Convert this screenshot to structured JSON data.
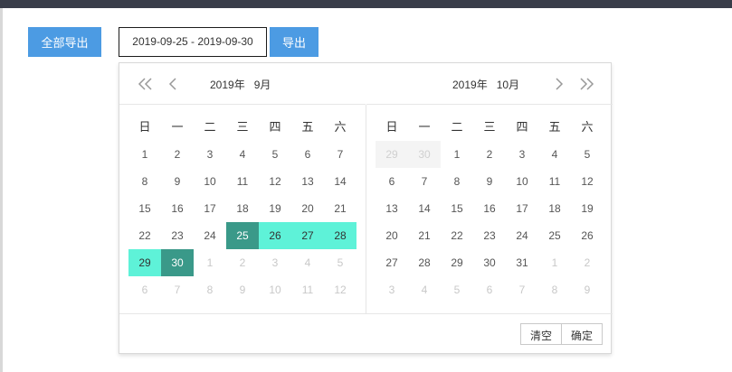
{
  "toolbar": {
    "export_all_label": "全部导出",
    "date_range_value": "2019-09-25 - 2019-09-30",
    "export_label": "导出"
  },
  "picker": {
    "left": {
      "year_label": "2019年",
      "month_label": "9月",
      "weekdays": [
        "日",
        "一",
        "二",
        "三",
        "四",
        "五",
        "六"
      ],
      "days": [
        {
          "label": "1",
          "state": "current"
        },
        {
          "label": "2",
          "state": "current"
        },
        {
          "label": "3",
          "state": "current"
        },
        {
          "label": "4",
          "state": "current"
        },
        {
          "label": "5",
          "state": "current"
        },
        {
          "label": "6",
          "state": "current"
        },
        {
          "label": "7",
          "state": "current"
        },
        {
          "label": "8",
          "state": "current"
        },
        {
          "label": "9",
          "state": "current"
        },
        {
          "label": "10",
          "state": "current"
        },
        {
          "label": "11",
          "state": "current"
        },
        {
          "label": "12",
          "state": "current"
        },
        {
          "label": "13",
          "state": "current"
        },
        {
          "label": "14",
          "state": "current"
        },
        {
          "label": "15",
          "state": "current"
        },
        {
          "label": "16",
          "state": "current"
        },
        {
          "label": "17",
          "state": "current"
        },
        {
          "label": "18",
          "state": "current"
        },
        {
          "label": "19",
          "state": "current"
        },
        {
          "label": "20",
          "state": "current"
        },
        {
          "label": "21",
          "state": "current"
        },
        {
          "label": "22",
          "state": "current"
        },
        {
          "label": "23",
          "state": "current"
        },
        {
          "label": "24",
          "state": "current"
        },
        {
          "label": "25",
          "state": "selected"
        },
        {
          "label": "26",
          "state": "inrange"
        },
        {
          "label": "27",
          "state": "inrange"
        },
        {
          "label": "28",
          "state": "inrange"
        },
        {
          "label": "29",
          "state": "inrange"
        },
        {
          "label": "30",
          "state": "selected"
        },
        {
          "label": "1",
          "state": "other"
        },
        {
          "label": "2",
          "state": "other"
        },
        {
          "label": "3",
          "state": "other"
        },
        {
          "label": "4",
          "state": "other"
        },
        {
          "label": "5",
          "state": "other"
        },
        {
          "label": "6",
          "state": "other"
        },
        {
          "label": "7",
          "state": "other"
        },
        {
          "label": "8",
          "state": "other"
        },
        {
          "label": "9",
          "state": "other"
        },
        {
          "label": "10",
          "state": "other"
        },
        {
          "label": "11",
          "state": "other"
        },
        {
          "label": "12",
          "state": "other"
        }
      ]
    },
    "right": {
      "year_label": "2019年",
      "month_label": "10月",
      "weekdays": [
        "日",
        "一",
        "二",
        "三",
        "四",
        "五",
        "六"
      ],
      "days": [
        {
          "label": "29",
          "state": "disabled"
        },
        {
          "label": "30",
          "state": "disabled"
        },
        {
          "label": "1",
          "state": "current"
        },
        {
          "label": "2",
          "state": "current"
        },
        {
          "label": "3",
          "state": "current"
        },
        {
          "label": "4",
          "state": "current"
        },
        {
          "label": "5",
          "state": "current"
        },
        {
          "label": "6",
          "state": "current"
        },
        {
          "label": "7",
          "state": "current"
        },
        {
          "label": "8",
          "state": "current"
        },
        {
          "label": "9",
          "state": "current"
        },
        {
          "label": "10",
          "state": "current"
        },
        {
          "label": "11",
          "state": "current"
        },
        {
          "label": "12",
          "state": "current"
        },
        {
          "label": "13",
          "state": "current"
        },
        {
          "label": "14",
          "state": "current"
        },
        {
          "label": "15",
          "state": "current"
        },
        {
          "label": "16",
          "state": "current"
        },
        {
          "label": "17",
          "state": "current"
        },
        {
          "label": "18",
          "state": "current"
        },
        {
          "label": "19",
          "state": "current"
        },
        {
          "label": "20",
          "state": "current"
        },
        {
          "label": "21",
          "state": "current"
        },
        {
          "label": "22",
          "state": "current"
        },
        {
          "label": "23",
          "state": "current"
        },
        {
          "label": "24",
          "state": "current"
        },
        {
          "label": "25",
          "state": "current"
        },
        {
          "label": "26",
          "state": "current"
        },
        {
          "label": "27",
          "state": "current"
        },
        {
          "label": "28",
          "state": "current"
        },
        {
          "label": "29",
          "state": "current"
        },
        {
          "label": "30",
          "state": "current"
        },
        {
          "label": "31",
          "state": "current"
        },
        {
          "label": "1",
          "state": "other"
        },
        {
          "label": "2",
          "state": "other"
        },
        {
          "label": "3",
          "state": "other"
        },
        {
          "label": "4",
          "state": "other"
        },
        {
          "label": "5",
          "state": "other"
        },
        {
          "label": "6",
          "state": "other"
        },
        {
          "label": "7",
          "state": "other"
        },
        {
          "label": "8",
          "state": "other"
        },
        {
          "label": "9",
          "state": "other"
        }
      ]
    },
    "nav_icons": {
      "prev_year": "double-chevron-left-icon",
      "prev_month": "chevron-left-icon",
      "next_month": "chevron-right-icon",
      "next_year": "double-chevron-right-icon"
    },
    "clear_label": "清空",
    "confirm_label": "确定"
  },
  "colors": {
    "button_blue": "#4c9be3",
    "selected_day": "#3a9989",
    "range_day": "#5ef2d8",
    "topbar": "#393d49"
  }
}
